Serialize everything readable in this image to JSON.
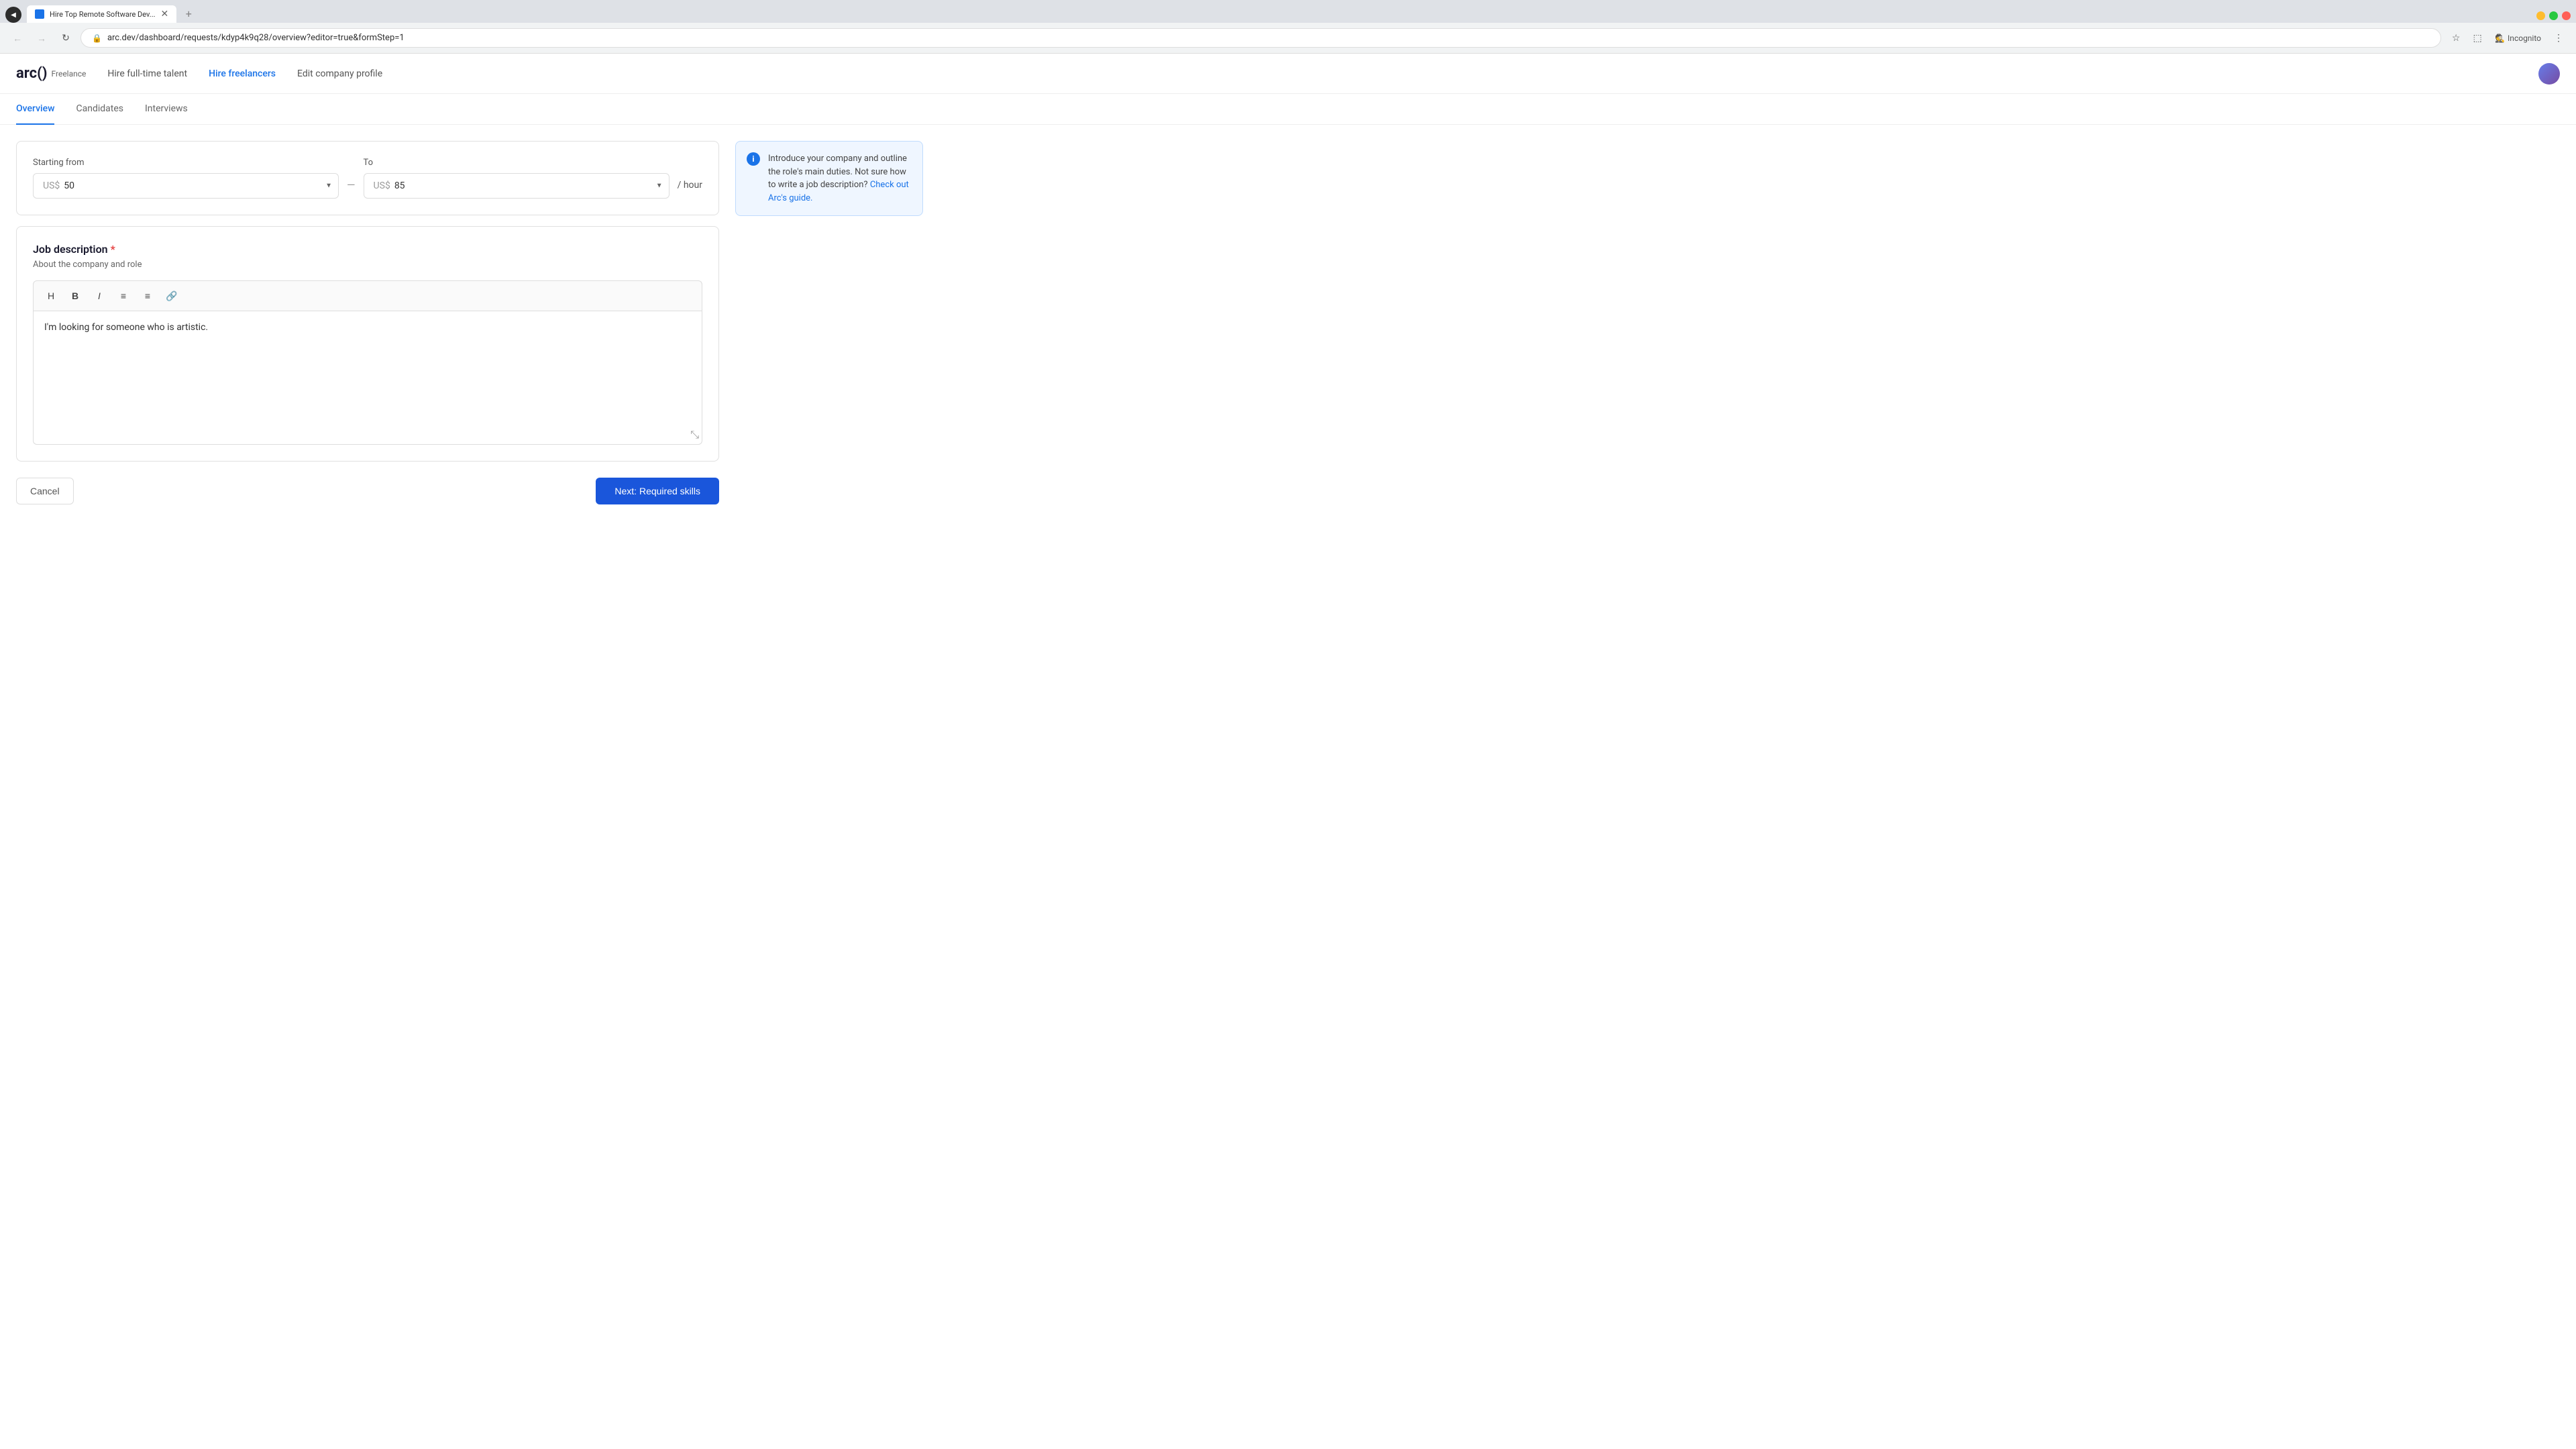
{
  "browser": {
    "tab": {
      "title": "Hire Top Remote Software Dev...",
      "favicon": "arc-favicon"
    },
    "new_tab_label": "+",
    "url": "arc.dev/dashboard/requests/kdyp4k9q28/overview?editor=true&formStep=1",
    "nav": {
      "back": "←",
      "forward": "→",
      "refresh": "↻"
    },
    "toolbar": {
      "bookmark_icon": "★",
      "extensions_icon": "⬜",
      "incognito_label": "Incognito",
      "menu_icon": "⋮"
    }
  },
  "app": {
    "logo": "arc()",
    "logo_suffix": "Freelance",
    "nav": {
      "hire_fulltime": "Hire full-time talent",
      "hire_freelancers": "Hire freelancers",
      "edit_company": "Edit company profile"
    }
  },
  "tabs": {
    "overview": "Overview",
    "candidates": "Candidates",
    "interviews": "Interviews"
  },
  "salary": {
    "from_label": "Starting from",
    "to_label": "To",
    "from_currency": "US$",
    "from_value": "50",
    "to_currency": "US$",
    "to_value": "85",
    "separator": "—",
    "per_hour": "/ hour"
  },
  "job_description": {
    "title": "Job description",
    "required_marker": "*",
    "subtitle": "About the company and role",
    "content": "I'm looking for someone who is artistic.",
    "toolbar": {
      "heading": "H",
      "bold": "B",
      "italic": "I",
      "bullet_list": "≡",
      "ordered_list": "≡",
      "link": "🔗"
    }
  },
  "help": {
    "icon": "i",
    "text_part1": "Introduce your company and outline the role's main duties. Not sure how to write a job description?",
    "link_text": "Check out Arc's guide.",
    "link_href": "#"
  },
  "actions": {
    "cancel": "Cancel",
    "next": "Next: Required skills"
  }
}
